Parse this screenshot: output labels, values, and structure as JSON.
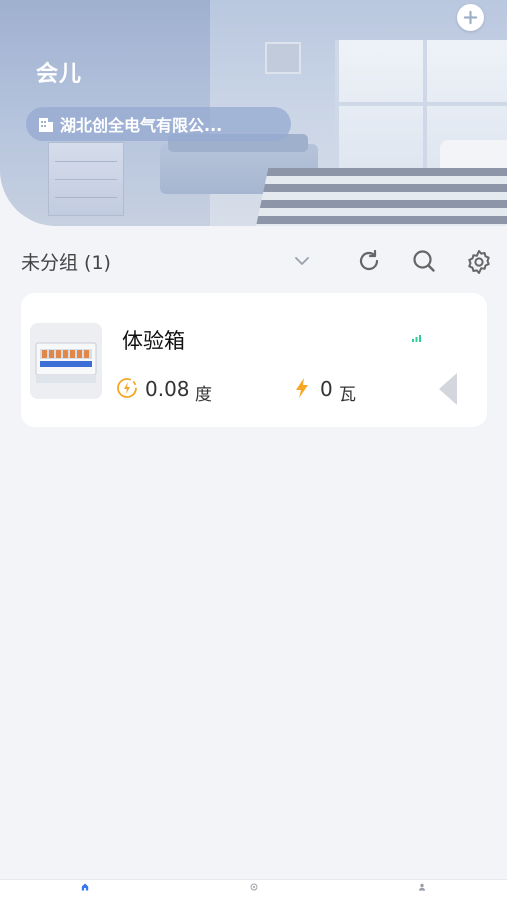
{
  "header": {
    "user_name": "会儿",
    "company_name": "湖北创全电气有限公...",
    "add_icon": "plus-circle-icon"
  },
  "group": {
    "title": "未分组 (1)",
    "icons": [
      "chevron-down-icon",
      "refresh-icon",
      "search-icon",
      "gear-icon"
    ]
  },
  "devices": [
    {
      "name": "体验箱",
      "energy_value": "0.08",
      "energy_unit": "度",
      "power_value": "0",
      "power_unit": "瓦",
      "signal_icon": "signal-icon",
      "energy_icon": "energy-circle-icon",
      "power_icon": "lightning-icon"
    }
  ],
  "bottom_nav": [
    {
      "icon": "home-icon",
      "active": true
    },
    {
      "icon": "scene-icon",
      "active": false
    },
    {
      "icon": "user-icon",
      "active": false
    }
  ],
  "colors": {
    "accent": "#3b78e7",
    "energy": "#f5a623",
    "background": "#f2f4f8"
  }
}
